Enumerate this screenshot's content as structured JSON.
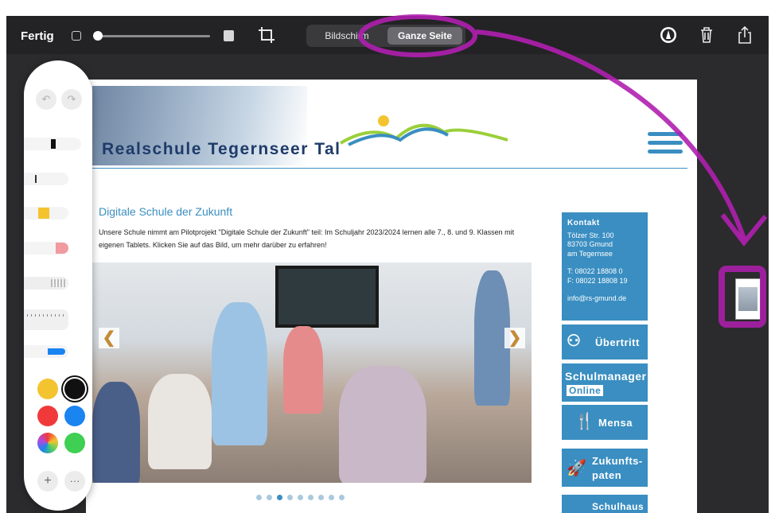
{
  "toolbar": {
    "done_label": "Fertig",
    "opacity_slider_value": 0.0,
    "segments": [
      "Bildschirm",
      "Ganze Seite"
    ],
    "selected_segment": "Ganze Seite",
    "icons": [
      "crop-icon",
      "markup-icon",
      "trash-icon",
      "share-icon"
    ]
  },
  "page": {
    "site_name": "Realschule Tegernseer Tal",
    "headline": "Digitale Schule der Zukunft",
    "intro": "Unsere Schule nimmt am Pilotprojekt \"Digitale Schule der Zukunft\" teil: Im Schuljahr 2023/2024 lernen alle 7., 8. und 9. Klassen mit eigenen Tablets. Klicken Sie auf das Bild, um mehr darüber zu erfahren!",
    "carousel": {
      "prev": "❮",
      "next": "❯",
      "dot_count": 9,
      "active_dot": 3
    },
    "contact": {
      "title": "Kontakt",
      "lines": [
        "Tölzer Str. 100",
        "83703 Gmund",
        "am Tegernsee"
      ],
      "phone": "T: 08022 18808 0",
      "fax": "F: 08022 18808 19",
      "email": "info@rs-gmund.de"
    },
    "cards": {
      "transfer": "Übertritt",
      "manager_1": "Schulmanager",
      "manager_2": "Online",
      "mensa": "Mensa",
      "mentor_1": "Zukunfts-",
      "mentor_2": "paten",
      "school": "Schulhaus"
    }
  },
  "palette": {
    "undo": "↶",
    "redo": "↷",
    "tools": [
      "pen",
      "pencil",
      "marker",
      "eraser",
      "lasso",
      "ruler",
      "fountain-pen"
    ],
    "colors": [
      "#f4c430",
      "#111111",
      "#f03a3a",
      "#1a84f0",
      "color-wheel",
      "#3fcf52"
    ],
    "selected_color": "#111111",
    "add": "+",
    "more": "···"
  },
  "annotation_color": "#b01fb0"
}
